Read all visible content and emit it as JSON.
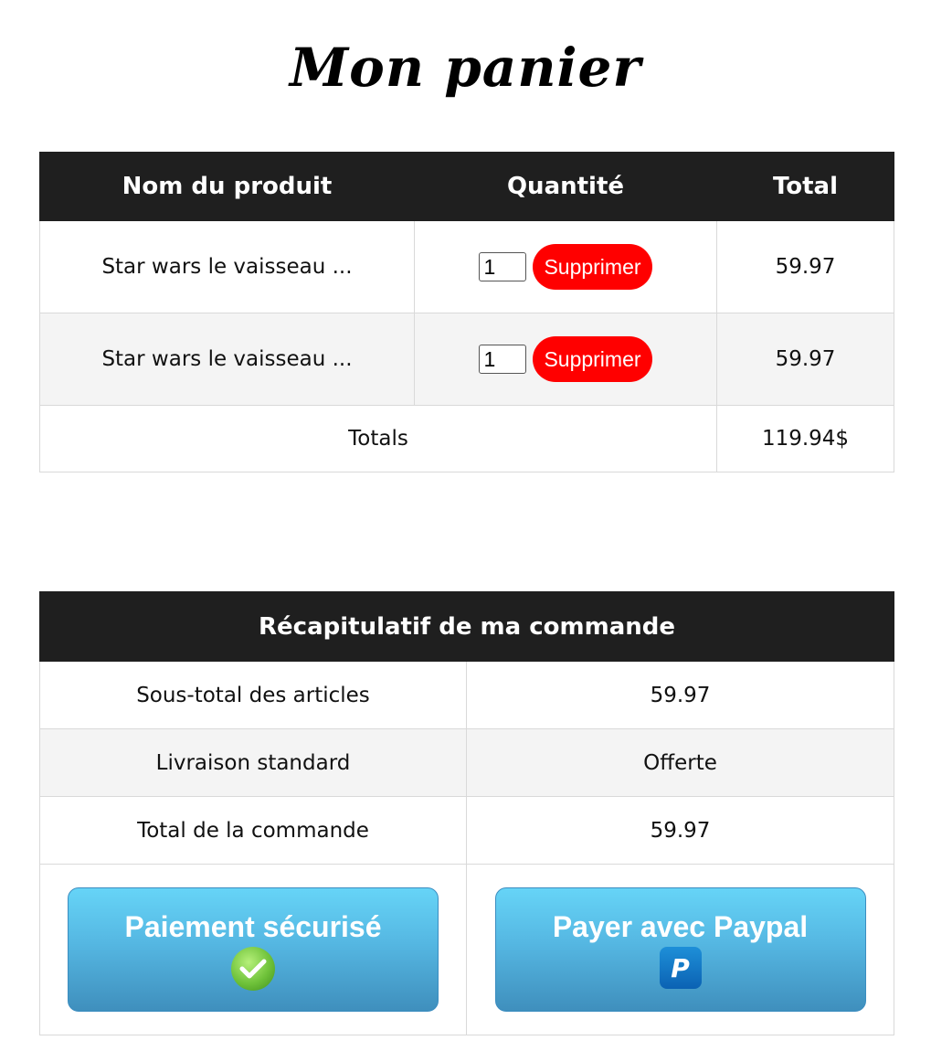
{
  "page": {
    "title": "Mon panier"
  },
  "cart": {
    "headers": {
      "name": "Nom du produit",
      "quantity": "Quantité",
      "total": "Total"
    },
    "items": [
      {
        "name": "Star wars le vaisseau ...",
        "quantity": "1",
        "remove_label": "Supprimer",
        "total": "59.97"
      },
      {
        "name": "Star wars le vaisseau ...",
        "quantity": "1",
        "remove_label": "Supprimer",
        "total": "59.97"
      }
    ],
    "totals": {
      "label": "Totals",
      "value": "119.94$"
    }
  },
  "summary": {
    "heading": "Récapitulatif de ma commande",
    "rows": [
      {
        "label": "Sous-total des articles",
        "value": "59.97"
      },
      {
        "label": "Livraison standard",
        "value": "Offerte"
      },
      {
        "label": "Total de la commande",
        "value": "59.97"
      }
    ],
    "secure_payment_label": "Paiement sécurisé",
    "secure_payment_icon": "check-icon",
    "paypal_label": "Payer avec Paypal",
    "paypal_icon": "paypal-icon"
  },
  "colors": {
    "header_bg": "#1f1f1f",
    "remove_button": "#ff0000",
    "pay_button": "#55b7e2"
  }
}
